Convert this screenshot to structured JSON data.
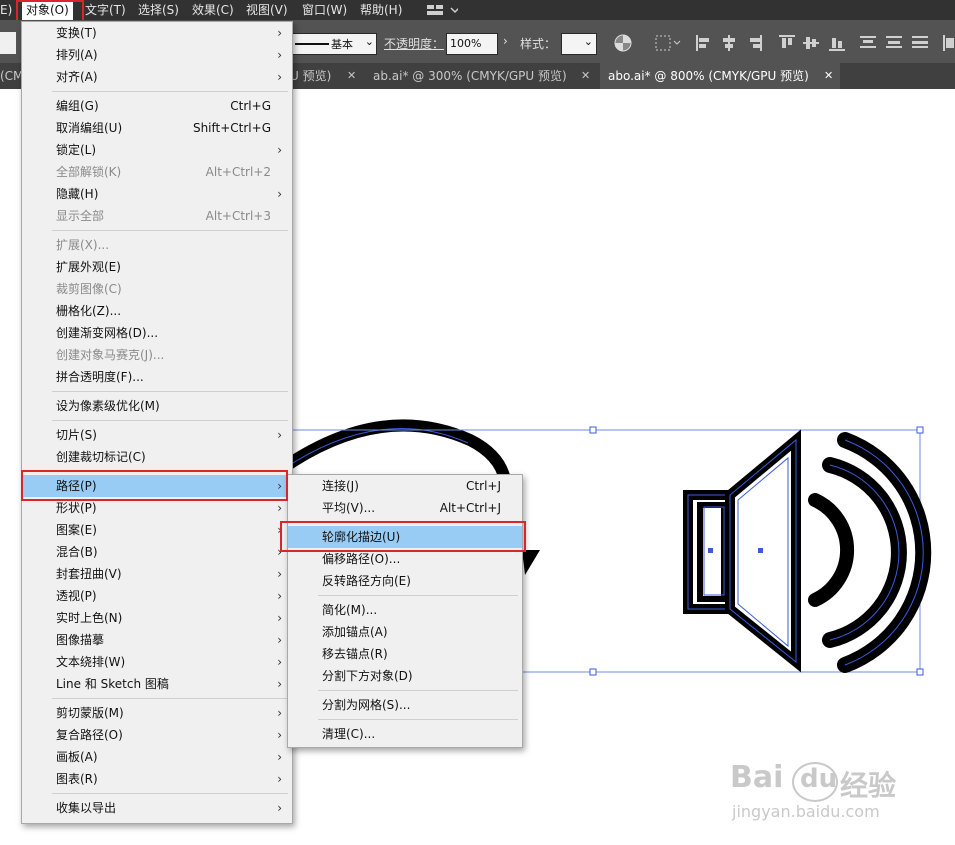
{
  "menubar": {
    "items": [
      "E)",
      "对象(O)",
      "文字(T)",
      "选择(S)",
      "效果(C)",
      "视图(V)",
      "窗口(W)",
      "帮助(H)"
    ],
    "active": "对象(O)"
  },
  "controlbar": {
    "stroke_label": "基本",
    "opacity_label": "不透明度：",
    "opacity_value": "100%",
    "style_label": "样式："
  },
  "tabs": [
    {
      "label": "(CM"
    },
    {
      "label": "U 预览)"
    },
    {
      "label": "ab.ai* @ 300% (CMYK/GPU 预览)"
    },
    {
      "label": "abo.ai* @ 800% (CMYK/GPU 预览)",
      "active": true
    }
  ],
  "object_menu": {
    "items": [
      {
        "label": "变换(T)",
        "submenu": true
      },
      {
        "label": "排列(A)",
        "submenu": true
      },
      {
        "label": "对齐(A)",
        "submenu": true
      },
      {
        "separator": true
      },
      {
        "label": "编组(G)",
        "shortcut": "Ctrl+G"
      },
      {
        "label": "取消编组(U)",
        "shortcut": "Shift+Ctrl+G"
      },
      {
        "label": "锁定(L)",
        "submenu": true
      },
      {
        "label": "全部解锁(K)",
        "shortcut": "Alt+Ctrl+2",
        "disabled": true
      },
      {
        "label": "隐藏(H)",
        "submenu": true
      },
      {
        "label": "显示全部",
        "shortcut": "Alt+Ctrl+3",
        "disabled": true
      },
      {
        "separator": true
      },
      {
        "label": "扩展(X)...",
        "disabled": true
      },
      {
        "label": "扩展外观(E)"
      },
      {
        "label": "裁剪图像(C)",
        "disabled": true
      },
      {
        "label": "栅格化(Z)..."
      },
      {
        "label": "创建渐变网格(D)..."
      },
      {
        "label": "创建对象马赛克(J)...",
        "disabled": true
      },
      {
        "label": "拼合透明度(F)..."
      },
      {
        "separator": true
      },
      {
        "label": "设为像素级优化(M)"
      },
      {
        "separator": true
      },
      {
        "label": "切片(S)",
        "submenu": true
      },
      {
        "label": "创建裁切标记(C)"
      },
      {
        "separator": true
      },
      {
        "label": "路径(P)",
        "submenu": true,
        "highlighted": true
      },
      {
        "label": "形状(P)",
        "submenu": true
      },
      {
        "label": "图案(E)",
        "submenu": true
      },
      {
        "label": "混合(B)",
        "submenu": true
      },
      {
        "label": "封套扭曲(V)",
        "submenu": true
      },
      {
        "label": "透视(P)",
        "submenu": true
      },
      {
        "label": "实时上色(N)",
        "submenu": true
      },
      {
        "label": "图像描摹",
        "submenu": true
      },
      {
        "label": "文本绕排(W)",
        "submenu": true
      },
      {
        "label": "Line 和 Sketch 图稿",
        "submenu": true
      },
      {
        "separator": true
      },
      {
        "label": "剪切蒙版(M)",
        "submenu": true
      },
      {
        "label": "复合路径(O)",
        "submenu": true
      },
      {
        "label": "画板(A)",
        "submenu": true
      },
      {
        "label": "图表(R)",
        "submenu": true
      },
      {
        "separator": true
      },
      {
        "label": "收集以导出",
        "submenu": true
      }
    ]
  },
  "path_submenu": {
    "items": [
      {
        "label": "连接(J)",
        "shortcut": "Ctrl+J"
      },
      {
        "label": "平均(V)...",
        "shortcut": "Alt+Ctrl+J"
      },
      {
        "separator": true
      },
      {
        "label": "轮廓化描边(U)",
        "highlighted": true
      },
      {
        "label": "偏移路径(O)..."
      },
      {
        "label": "反转路径方向(E)"
      },
      {
        "separator": true
      },
      {
        "label": "简化(M)..."
      },
      {
        "label": "添加锚点(A)"
      },
      {
        "label": "移去锚点(R)"
      },
      {
        "label": "分割下方对象(D)"
      },
      {
        "separator": true
      },
      {
        "label": "分割为网格(S)..."
      },
      {
        "separator": true
      },
      {
        "label": "清理(C)..."
      }
    ]
  },
  "watermark": {
    "brand": "Bai",
    "brand2": "du",
    "brand_cn": "经验",
    "url": "jingyan.baidu.com"
  },
  "colors": {
    "highlight": "#99ccf5",
    "annotation_red": "#d9262b",
    "selection_blue": "#3b5bdb"
  }
}
